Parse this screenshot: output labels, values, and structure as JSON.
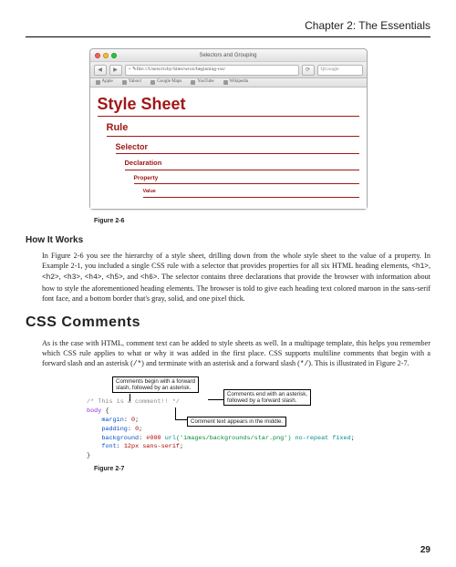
{
  "header": {
    "chapter": "Chapter 2: The Essentials"
  },
  "browser": {
    "title": "Selectors and Grouping",
    "address": "file:///Users/richy/Sites/wrox/beginning-css/",
    "search_placeholder": "Google",
    "bookmarks": [
      "Apple",
      "Yahoo!",
      "Google Maps",
      "YouTube",
      "Wikipedia"
    ]
  },
  "style_hierarchy": {
    "l1": "Style Sheet",
    "l2": "Rule",
    "l3": "Selector",
    "l4": "Declaration",
    "l5": "Property",
    "l6": "Value"
  },
  "fig26_caption": "Figure 2-6",
  "how_heading": "How It Works",
  "how_para_a": "In Figure 2-6 you see the hierarchy of a style sheet, drilling down from the whole style sheet to the value of a property. In Example 2-1, you included a single CSS rule with a selector that provides properties for all six HTML heading elements, ",
  "how_tags": [
    "<h1>",
    "<h2>",
    "<h3>",
    "<h4>",
    "<h5>",
    "<h6>"
  ],
  "how_para_b": ". The selector contains three declarations that provide the browser with information about how to style the aforementioned heading elements. The browser is told to give each heading text colored maroon in the sans-serif font face, and a bottom border that's gray, solid, and one pixel thick.",
  "section_heading": "CSS Comments",
  "comments_para_a": "As is the case with HTML, comment text can be added to style sheets as well. In a multipage template, this helps you remember which CSS rule applies to what or why it was added in the first place. CSS supports multiline comments that begin with a forward slash and an asterisk (",
  "open_tok": "/*",
  "comments_para_b": ") and terminate with an asterisk and a forward slash (",
  "close_tok": "*/",
  "comments_para_c": "). This is illustrated in Figure 2-7.",
  "callout1": "Comments begin with a forward\nslash, followed by an asterisk.",
  "callout2": "Comments end with an asterisk,\nfollowed by a forward slash.",
  "callout3": "Comment text appears in the middle.",
  "code": {
    "comment": "/* This is a comment!! */",
    "sel": "body",
    "brace_open": " {",
    "p1k": "margin",
    "p1v": "0",
    "p2k": "padding",
    "p2v": "0",
    "p3k": "background",
    "p3v_a": "#000",
    "p3v_b": "url",
    "p3v_c": "('images/backgrounds/star.png')",
    "p3v_d": "no-repeat fixed",
    "p4k": "font",
    "p4v": "12px sans-serif",
    "brace_close": "}"
  },
  "fig27_caption": "Figure 2-7",
  "page_number": "29"
}
